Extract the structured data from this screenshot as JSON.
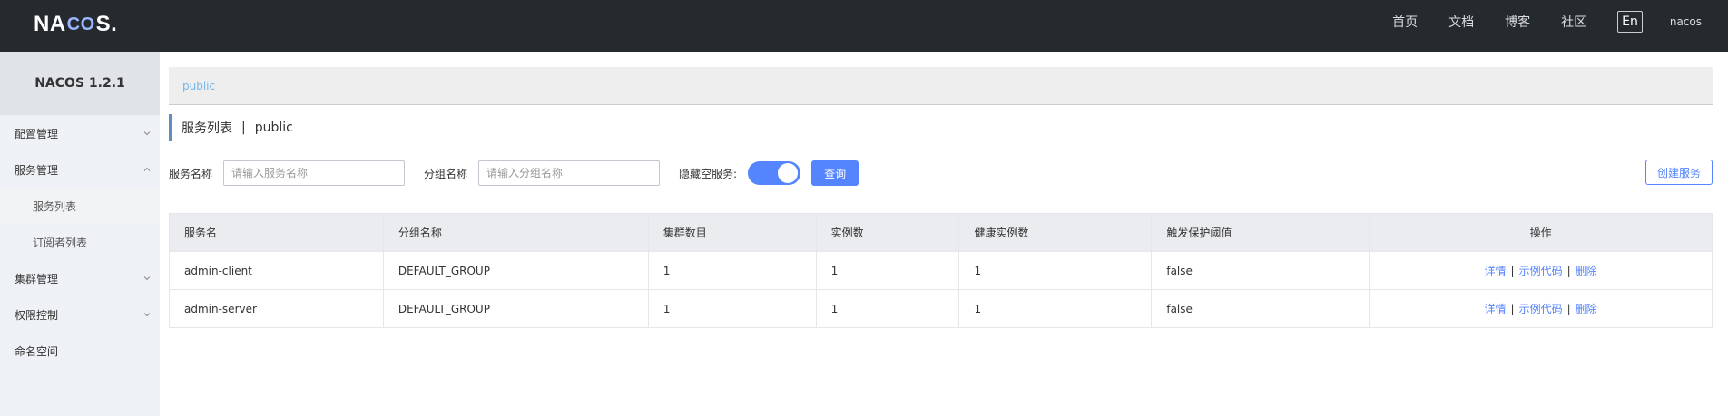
{
  "header": {
    "logo": {
      "left": "NA",
      "mid": "CO",
      "right": "S."
    },
    "nav": [
      "首页",
      "文档",
      "博客",
      "社区"
    ],
    "lang": "En",
    "user": "nacos"
  },
  "sidebar": {
    "title": "NACOS 1.2.1",
    "items": [
      {
        "label": "配置管理"
      },
      {
        "label": "服务管理"
      },
      {
        "label": "服务列表"
      },
      {
        "label": "订阅者列表"
      },
      {
        "label": "集群管理"
      },
      {
        "label": "权限控制"
      },
      {
        "label": "命名空间"
      }
    ]
  },
  "main": {
    "namespace": "public",
    "title": "服务列表",
    "title_sep": "|",
    "title_ns": "public",
    "filters": {
      "service_label": "服务名称",
      "service_placeholder": "请输入服务名称",
      "group_label": "分组名称",
      "group_placeholder": "请输入分组名称",
      "hide_empty_label": "隐藏空服务:",
      "hide_empty_on": true,
      "query_label": "查询",
      "create_label": "创建服务"
    },
    "table": {
      "headers": [
        "服务名",
        "分组名称",
        "集群数目",
        "实例数",
        "健康实例数",
        "触发保护阈值",
        "操作"
      ],
      "rows": [
        {
          "cells": [
            "admin-client",
            "DEFAULT_GROUP",
            "1",
            "1",
            "1",
            "false"
          ]
        },
        {
          "cells": [
            "admin-server",
            "DEFAULT_GROUP",
            "1",
            "1",
            "1",
            "false"
          ]
        }
      ],
      "ops": {
        "detail": "详情",
        "code": "示例代码",
        "delete": "删除",
        "sep": "|"
      }
    }
  },
  "colors": {
    "header_bg": "#252a2f",
    "accent": "#5584ff",
    "link_public": "#76b7e8"
  }
}
